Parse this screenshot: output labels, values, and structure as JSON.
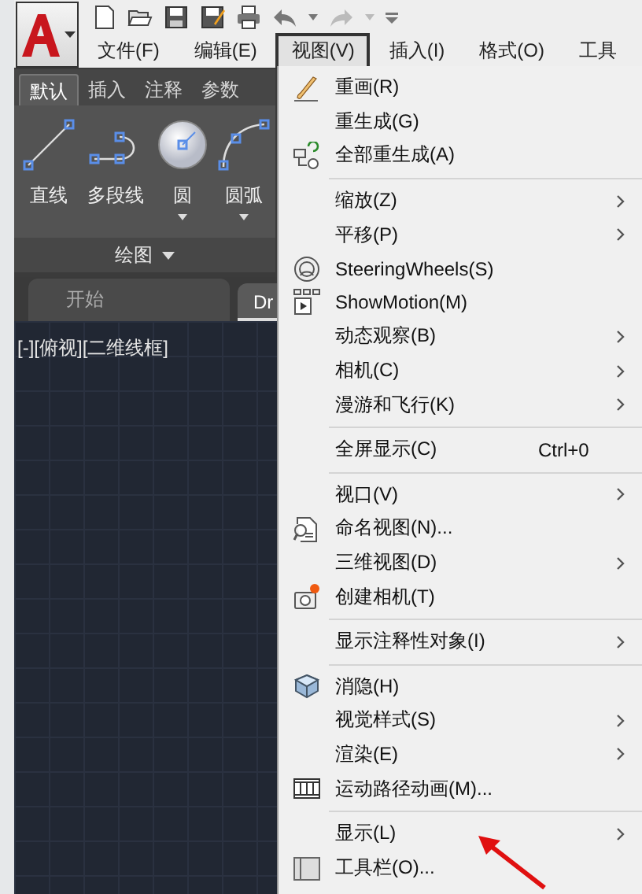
{
  "menu_bar": [
    {
      "label": "文件(F)",
      "selected": false
    },
    {
      "label": "编辑(E)",
      "selected": false
    },
    {
      "label": "视图(V)",
      "selected": true
    },
    {
      "label": "插入(I)",
      "selected": false
    },
    {
      "label": "格式(O)",
      "selected": false
    },
    {
      "label": "工具",
      "selected": false
    }
  ],
  "ribbon": {
    "tabs": [
      {
        "label": "默认",
        "selected": true
      },
      {
        "label": "插入",
        "selected": false
      },
      {
        "label": "注释",
        "selected": false
      },
      {
        "label": "参数",
        "selected": false
      }
    ],
    "tools": [
      {
        "label": "直线",
        "dropdown": false
      },
      {
        "label": "多段线",
        "dropdown": false
      },
      {
        "label": "圆",
        "dropdown": true
      },
      {
        "label": "圆弧",
        "dropdown": true
      }
    ],
    "panel_title": "绘图"
  },
  "file_tabs": [
    {
      "label": "开始",
      "selected": false
    },
    {
      "label": "Dr",
      "selected": true
    }
  ],
  "viewport_label": "[-][俯视][二维线框]",
  "menu": {
    "items": [
      {
        "kind": "item",
        "label": "重画(R)",
        "submenu": false
      },
      {
        "kind": "item",
        "label": "重生成(G)",
        "submenu": false
      },
      {
        "kind": "item",
        "label": "全部重生成(A)",
        "submenu": false
      },
      {
        "kind": "separator"
      },
      {
        "kind": "item",
        "label": "缩放(Z)",
        "submenu": true
      },
      {
        "kind": "item",
        "label": "平移(P)",
        "submenu": true
      },
      {
        "kind": "item",
        "label": "SteeringWheels(S)",
        "submenu": false
      },
      {
        "kind": "item",
        "label": "ShowMotion(M)",
        "submenu": false
      },
      {
        "kind": "item",
        "label": "动态观察(B)",
        "submenu": true
      },
      {
        "kind": "item",
        "label": "相机(C)",
        "submenu": true
      },
      {
        "kind": "item",
        "label": "漫游和飞行(K)",
        "submenu": true
      },
      {
        "kind": "separator"
      },
      {
        "kind": "item",
        "label": "全屏显示(C)",
        "shortcut": "Ctrl+0",
        "submenu": false
      },
      {
        "kind": "separator"
      },
      {
        "kind": "item",
        "label": "视口(V)",
        "submenu": true
      },
      {
        "kind": "item",
        "label": "命名视图(N)...",
        "submenu": false
      },
      {
        "kind": "item",
        "label": "三维视图(D)",
        "submenu": true
      },
      {
        "kind": "item",
        "label": "创建相机(T)",
        "submenu": false
      },
      {
        "kind": "separator"
      },
      {
        "kind": "item",
        "label": "显示注释性对象(I)",
        "submenu": true
      },
      {
        "kind": "separator"
      },
      {
        "kind": "item",
        "label": "消隐(H)",
        "submenu": false
      },
      {
        "kind": "item",
        "label": "视觉样式(S)",
        "submenu": true
      },
      {
        "kind": "item",
        "label": "渲染(E)",
        "submenu": true
      },
      {
        "kind": "item",
        "label": "运动路径动画(M)...",
        "submenu": false
      },
      {
        "kind": "separator"
      },
      {
        "kind": "item",
        "label": "显示(L)",
        "submenu": true
      },
      {
        "kind": "item",
        "label": "工具栏(O)...",
        "submenu": false
      }
    ]
  }
}
